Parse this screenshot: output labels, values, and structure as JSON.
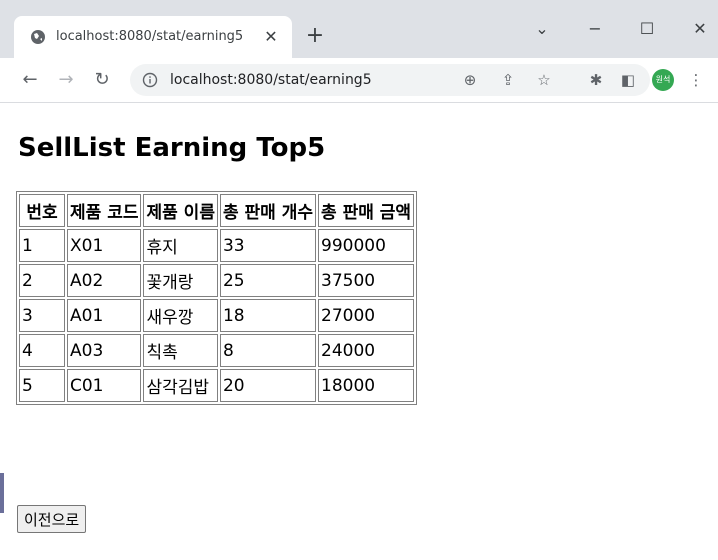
{
  "browser": {
    "tab_title": "localhost:8080/stat/earning5",
    "url": "localhost:8080/stat/earning5",
    "profile_label": "원석"
  },
  "page": {
    "title": "SellList Earning Top5",
    "table": {
      "headers": [
        "번호",
        "제품 코드",
        "제품 이름",
        "총 판매 개수",
        "총 판매 금액"
      ],
      "rows": [
        [
          "1",
          "X01",
          "휴지",
          "33",
          "990000"
        ],
        [
          "2",
          "A02",
          "꽃개랑",
          "25",
          "37500"
        ],
        [
          "3",
          "A01",
          "새우깡",
          "18",
          "27000"
        ],
        [
          "4",
          "A03",
          "칙촉",
          "8",
          "24000"
        ],
        [
          "5",
          "C01",
          "삼각김밥",
          "20",
          "18000"
        ]
      ]
    },
    "back_button_label": "이전으로"
  }
}
